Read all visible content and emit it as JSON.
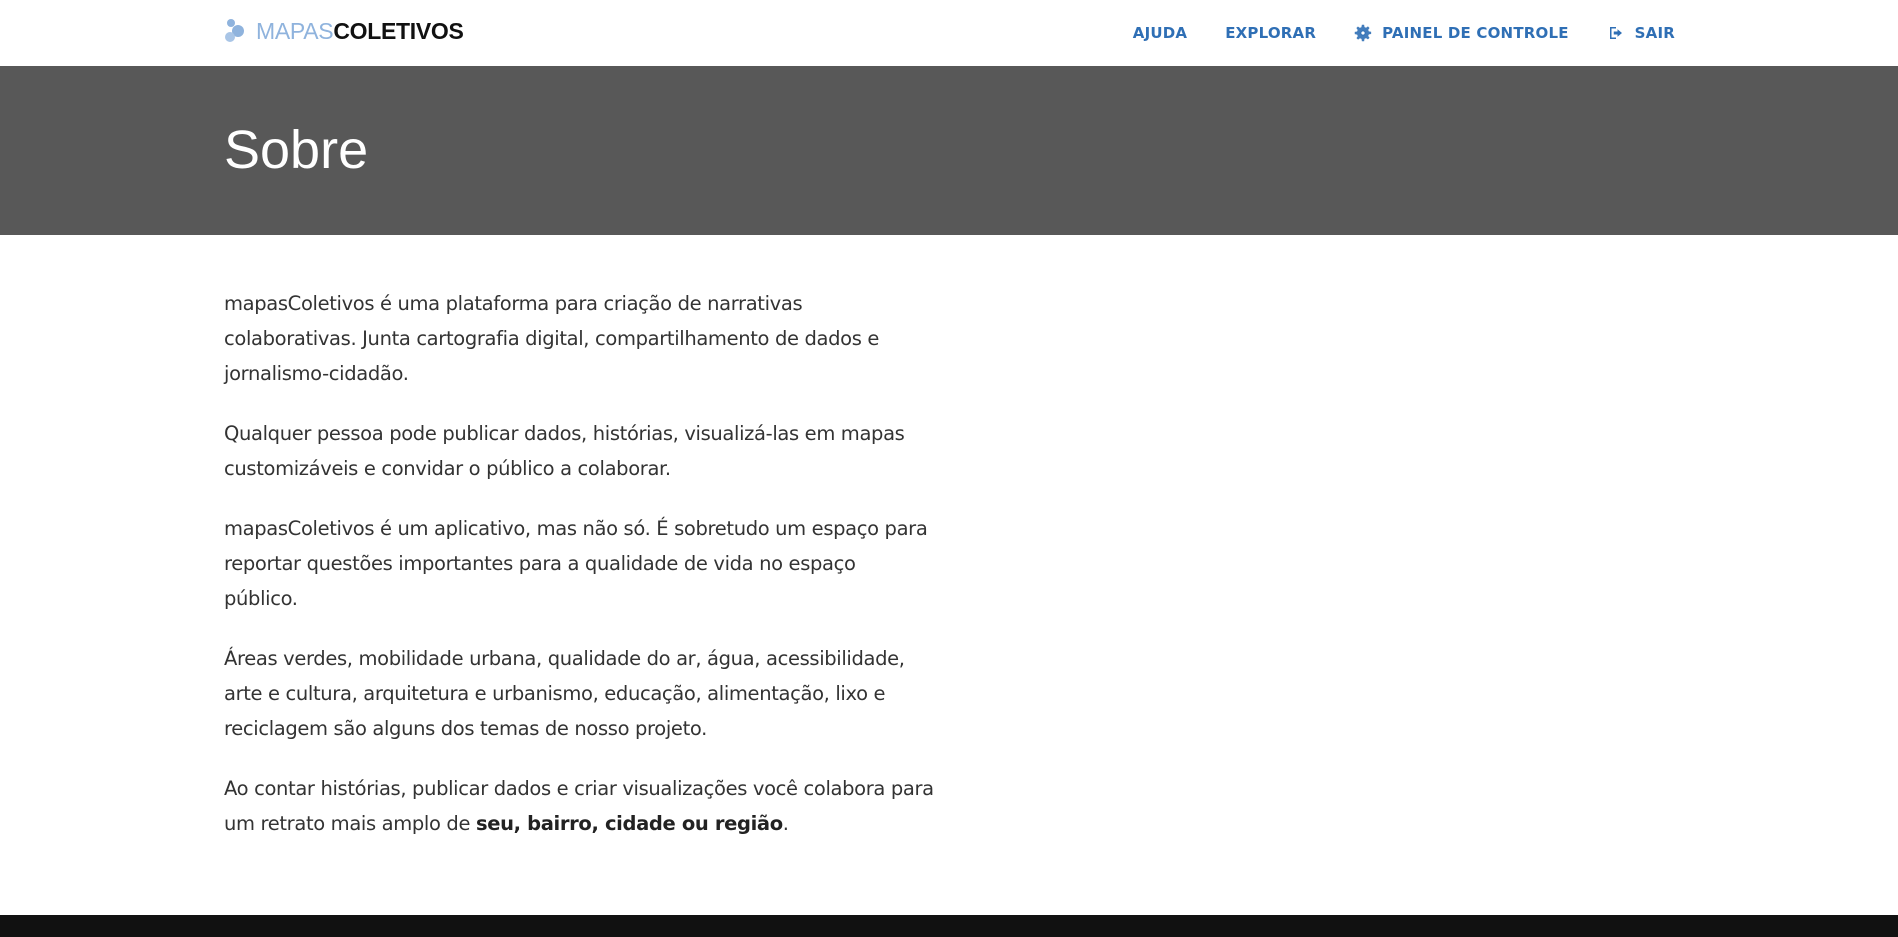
{
  "header": {
    "logo_light": "MAPAS",
    "logo_bold": "COLETIVOS",
    "nav": [
      {
        "label": "AJUDA",
        "icon": ""
      },
      {
        "label": "EXPLORAR",
        "icon": ""
      },
      {
        "label": "PAINEL DE CONTROLE",
        "icon": "gear-icon"
      },
      {
        "label": "SAIR",
        "icon": "sign-out-icon"
      }
    ]
  },
  "hero": {
    "title": "Sobre"
  },
  "content": {
    "p1": "mapasColetivos é uma plataforma para criação de narrativas colaborativas. Junta cartografia digital, compartilhamento de dados e jornalismo-cidadão.",
    "p2": "Qualquer pessoa pode publicar dados, histórias, visualizá-las em mapas customizáveis e convidar o público a colaborar.",
    "p3": "mapasColetivos é um aplicativo, mas não só. É sobretudo um espaço para reportar questões importantes para a qualidade de vida no espaço público.",
    "p4": "Áreas verdes, mobilidade urbana, qualidade do ar, água, acessibilidade, arte e cultura, arquitetura e urbanismo, educação, alimentação, lixo e reciclagem são alguns dos temas de nosso projeto.",
    "p5_start": "Ao contar histórias, publicar dados e criar visualizações você colabora para um retrato mais amplo de ",
    "p5_bold": "seu, bairro, cidade ou região",
    "p5_end": "."
  },
  "colors": {
    "nav_link": "#2f6fb5",
    "hero_bg": "#585858",
    "logo_light": "#8fb3dd",
    "footer_bg": "#111111"
  }
}
